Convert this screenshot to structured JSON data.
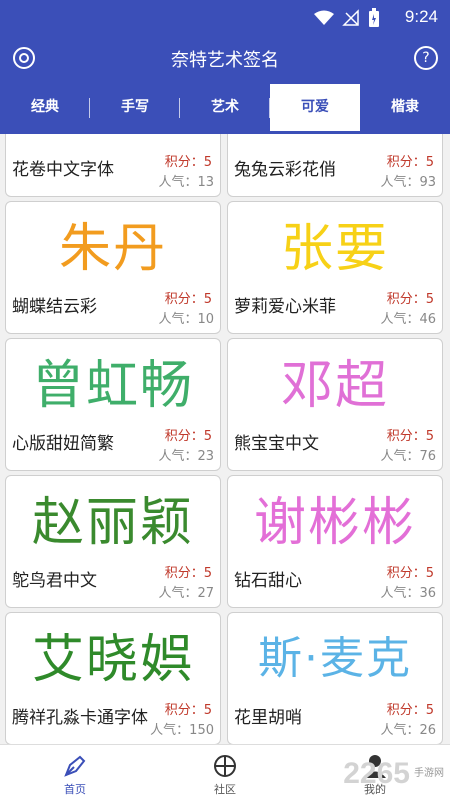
{
  "status": {
    "time": "9:24",
    "battery_icon": "battery-icon",
    "wifi_icon": "wifi-icon",
    "signal_icon": "no-signal-icon"
  },
  "app": {
    "title": "奈特艺术签名",
    "accent": "#3b4fb8",
    "left_icon": "at-sign-icon",
    "right_icon": "help-icon",
    "right_icon_glyph": "?"
  },
  "tabs": [
    {
      "label": "经典"
    },
    {
      "label": "手写"
    },
    {
      "label": "艺术"
    },
    {
      "label": "可爱",
      "active": true
    },
    {
      "label": "楷隶"
    }
  ],
  "cards": [
    {
      "name": "花卷中文字体",
      "score": "积分：5",
      "pop": "人气：13",
      "art": "",
      "color": "#333"
    },
    {
      "name": "兔兔云彩花俏",
      "score": "积分：5",
      "pop": "人气：93",
      "art": "",
      "color": "#333"
    },
    {
      "name": "蝴蝶结云彩",
      "score": "积分：5",
      "pop": "人气：10",
      "art": "朱丹",
      "color": "#f29c1f"
    },
    {
      "name": "萝莉爱心米菲",
      "score": "积分：5",
      "pop": "人气：46",
      "art": "张要",
      "color": "#f7d117"
    },
    {
      "name": "心版甜妞简繁",
      "score": "积分：5",
      "pop": "人气：23",
      "art": "曾虹畅",
      "color": "#3fae6a"
    },
    {
      "name": "熊宝宝中文",
      "score": "积分：5",
      "pop": "人气：76",
      "art": "邓超",
      "color": "#e070d6"
    },
    {
      "name": "鸵鸟君中文",
      "score": "积分：5",
      "pop": "人气：27",
      "art": "赵丽颖",
      "color": "#3a8a2e"
    },
    {
      "name": "钻石甜心",
      "score": "积分：5",
      "pop": "人气：36",
      "art": "谢彬彬",
      "color": "#e36fd7"
    },
    {
      "name": "腾祥孔淼卡通字体",
      "score": "积分：5",
      "pop": "人气：150",
      "art": "艾晓娯",
      "color": "#2f8a2a"
    },
    {
      "name": "花里胡哨",
      "score": "积分：5",
      "pop": "人气：26",
      "art": "斯·麦克",
      "color": "#5bb3e6"
    }
  ],
  "bottom_nav": [
    {
      "label": "首页",
      "icon": "pen-nib-icon",
      "active": true
    },
    {
      "label": "社区",
      "icon": "basketball-icon"
    },
    {
      "label": "我的",
      "icon": "person-icon"
    }
  ],
  "watermark": {
    "number": "2265",
    "text": "手游网"
  }
}
